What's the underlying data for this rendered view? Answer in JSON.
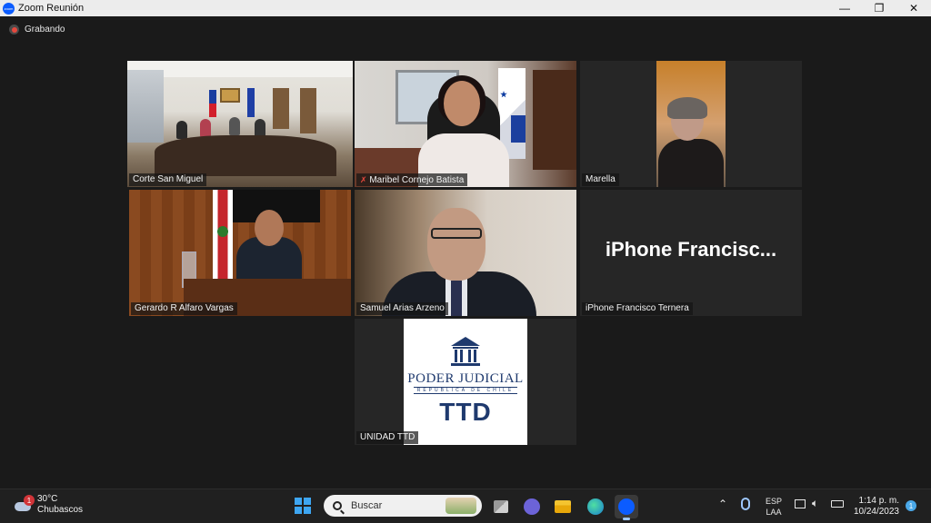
{
  "window": {
    "title": "Zoom Reunión",
    "minimize_glyph": "—",
    "restore_glyph": "❐",
    "close_glyph": "✕"
  },
  "recording": {
    "label": "Grabando"
  },
  "participants": [
    {
      "name": "Corte San Miguel",
      "active_speaker": true
    },
    {
      "name": "Maribel Cornejo Batista"
    },
    {
      "name": "Marella"
    },
    {
      "name": "Gerardo R Alfaro Vargas"
    },
    {
      "name": "Samuel Arias Arzeno"
    },
    {
      "name": "iPhone  Francisco Ternera",
      "display_text": "iPhone   Francisc..."
    },
    {
      "name": "UNIDAD TTD",
      "logo_line1": "PODER JUDICIAL",
      "logo_line2": "REPUBLICA DE CHILE",
      "logo_line3": "TTD"
    }
  ],
  "taskbar": {
    "weather": {
      "temp": "30°C",
      "desc": "Chubascos",
      "badge": "1"
    },
    "search_placeholder": "Buscar",
    "apps": [
      "windows-start",
      "search",
      "task-view",
      "teams-chat",
      "file-explorer",
      "edge",
      "zoom"
    ],
    "language": {
      "line1": "ESP",
      "line2": "LAA"
    },
    "clock": {
      "time": "1:14 p. m.",
      "date": "10/24/2023"
    },
    "notification_count": "1"
  },
  "colors": {
    "active_speaker_border": "#d6e45a",
    "zoom_blue": "#0b5cff",
    "taskbar_bg": "#202020"
  }
}
